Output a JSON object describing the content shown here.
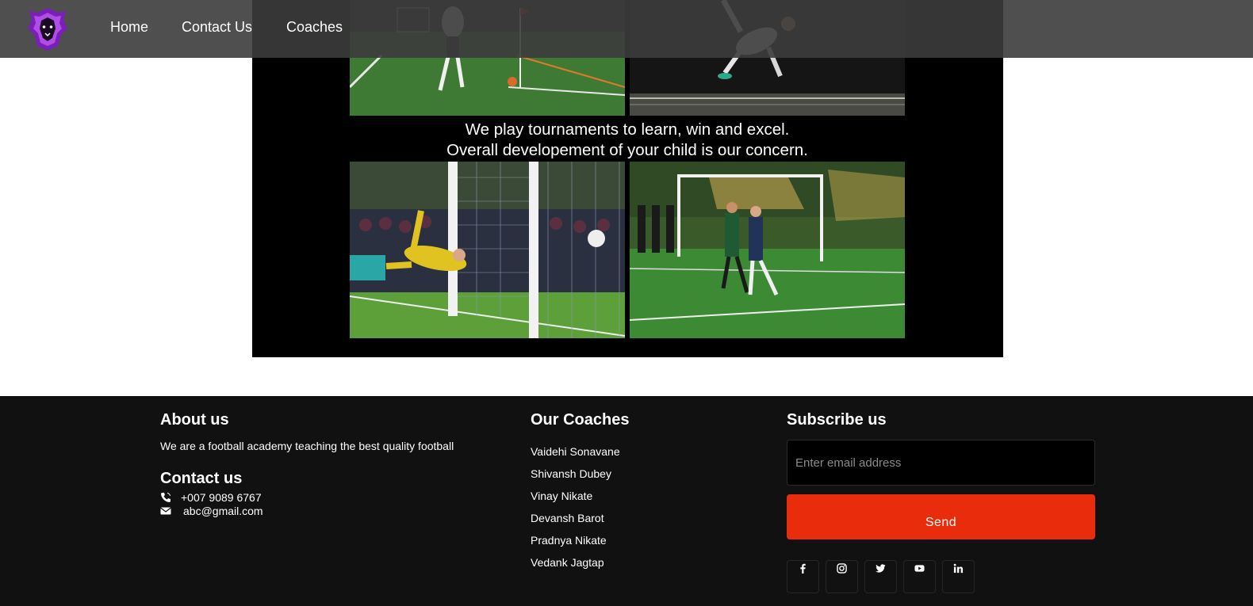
{
  "nav": {
    "links": [
      "Home",
      "Contact Us",
      "Coaches"
    ],
    "logo_icon": "lion-logo-icon"
  },
  "gallery": {
    "caption_line1": "We play tournaments to learn, win and excel.",
    "caption_line2": "Overall developement of your child is our concern."
  },
  "footer": {
    "about": {
      "heading": "About us",
      "text": "We are a football academy teaching the best quality football"
    },
    "contact": {
      "heading": "Contact us",
      "phone": "+007 9089 6767",
      "email": "abc@gmail.com"
    },
    "coaches": {
      "heading": "Our Coaches",
      "names": [
        "Vaidehi Sonavane",
        "Shivansh Dubey",
        "Vinay Nikate",
        "Devansh Barot",
        "Pradnya Nikate",
        "Vedank Jagtap"
      ]
    },
    "subscribe": {
      "heading": "Subscribe us",
      "placeholder": "Enter email address",
      "button": "Send"
    },
    "social_icons": [
      "facebook-icon",
      "instagram-icon",
      "twitter-icon",
      "youtube-icon",
      "linkedin-icon"
    ]
  },
  "colors": {
    "accent": "#e82c0c",
    "footer_bg": "#111111",
    "nav_bg": "#3c3c3c",
    "logo_purple": "#8b2fc9"
  }
}
